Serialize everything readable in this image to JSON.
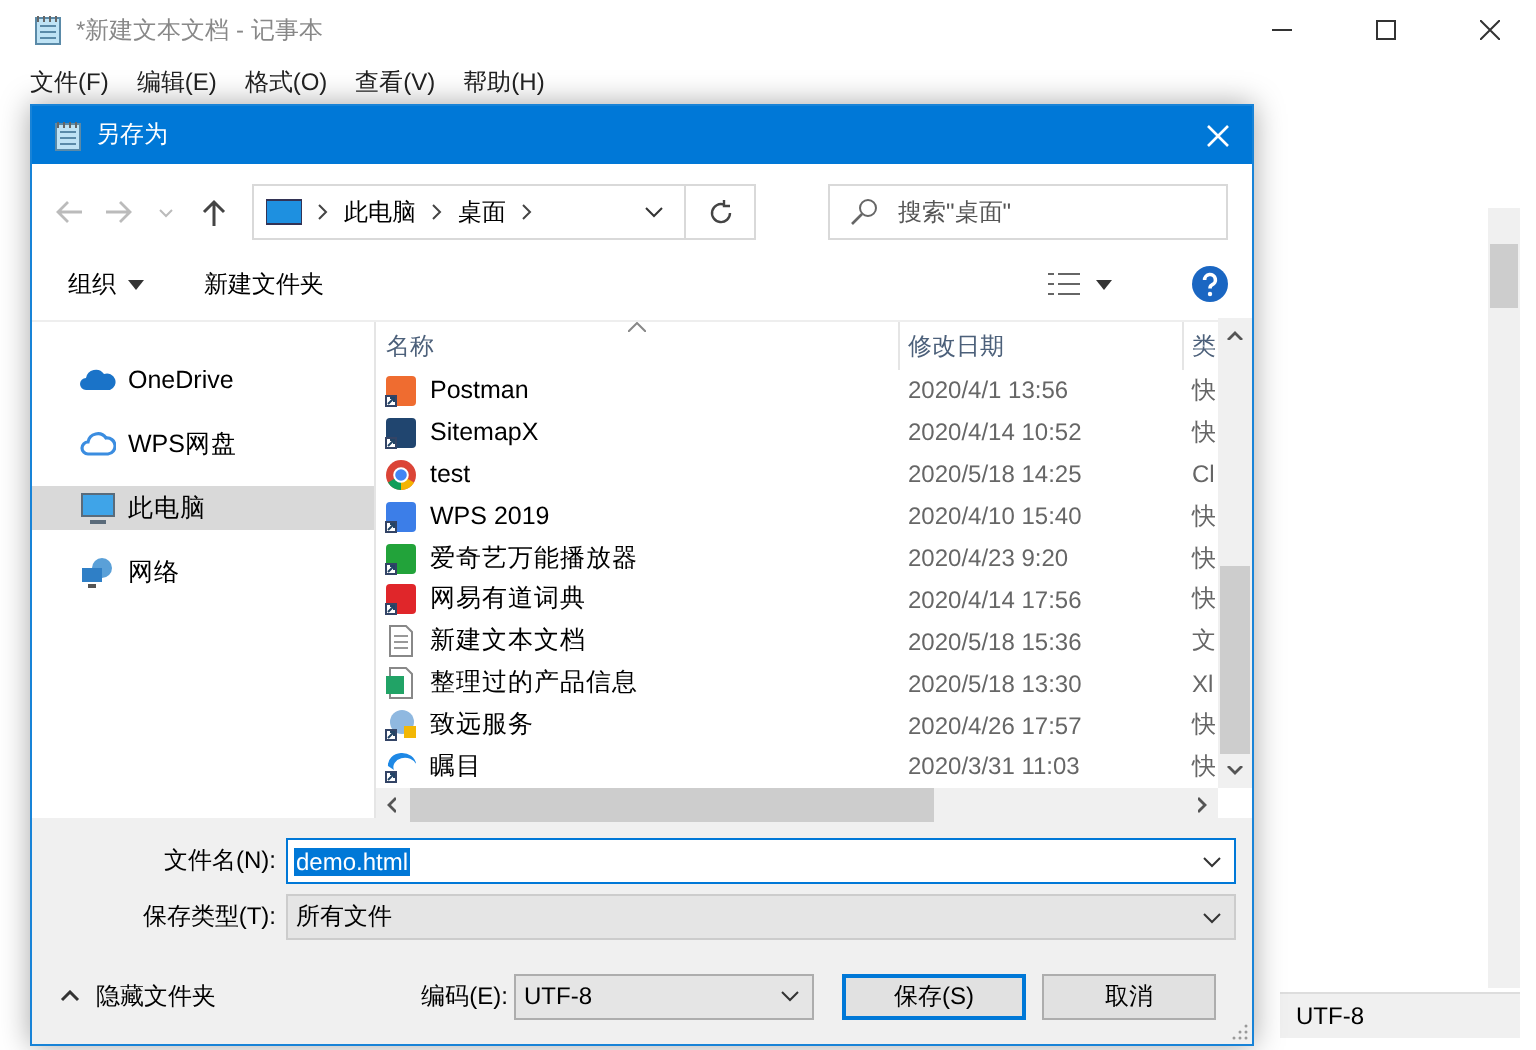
{
  "notepad": {
    "title": "*新建文本文档 - 记事本",
    "menu": [
      "文件(F)",
      "编辑(E)",
      "格式(O)",
      "查看(V)",
      "帮助(H)"
    ],
    "status_encoding": "UTF-8"
  },
  "dialog": {
    "title": "另存为",
    "path": [
      "此电脑",
      "桌面"
    ],
    "search": {
      "placeholder": "搜索\"桌面\""
    },
    "organize": "组织",
    "new_folder": "新建文件夹",
    "sidebar": [
      {
        "label": "OneDrive",
        "kind": "cloud",
        "selected": false
      },
      {
        "label": "WPS网盘",
        "kind": "outline",
        "selected": false
      },
      {
        "label": "此电脑",
        "kind": "computer",
        "selected": true
      },
      {
        "label": "网络",
        "kind": "network",
        "selected": false
      }
    ],
    "columns": [
      "名称",
      "修改日期",
      "类"
    ],
    "files": [
      {
        "name": "Postman",
        "date": "2020/4/1 13:56",
        "type": "快",
        "kind": "shortcut"
      },
      {
        "name": "SitemapX",
        "date": "2020/4/14 10:52",
        "type": "快",
        "kind": "shortcut"
      },
      {
        "name": "test",
        "date": "2020/5/18 14:25",
        "type": "Cl",
        "kind": "browser"
      },
      {
        "name": "WPS 2019",
        "date": "2020/4/10 15:40",
        "type": "快",
        "kind": "shortcut"
      },
      {
        "name": "爱奇艺万能播放器",
        "date": "2020/4/23 9:20",
        "type": "快",
        "kind": "shortcut"
      },
      {
        "name": "网易有道词典",
        "date": "2020/4/14 17:56",
        "type": "快",
        "kind": "shortcut"
      },
      {
        "name": "新建文本文档",
        "date": "2020/5/18 15:36",
        "type": "文",
        "kind": "text"
      },
      {
        "name": "整理过的产品信息",
        "date": "2020/5/18 13:30",
        "type": "Xl",
        "kind": "sheet"
      },
      {
        "name": "致远服务",
        "date": "2020/4/26 17:57",
        "type": "快",
        "kind": "globe"
      },
      {
        "name": "瞩目",
        "date": "2020/3/31 11:03",
        "type": "快",
        "kind": "swirl"
      }
    ],
    "filename": {
      "label": "文件名(N):",
      "value": "demo.html"
    },
    "filetype": {
      "label": "保存类型(T):",
      "value": "所有文件"
    },
    "hide_folders": "隐藏文件夹",
    "encoding": {
      "label": "编码(E):",
      "value": "UTF-8"
    },
    "buttons": [
      {
        "label": "保存(S)",
        "kind": "primary"
      },
      {
        "label": "取消",
        "kind": "normal"
      }
    ]
  }
}
